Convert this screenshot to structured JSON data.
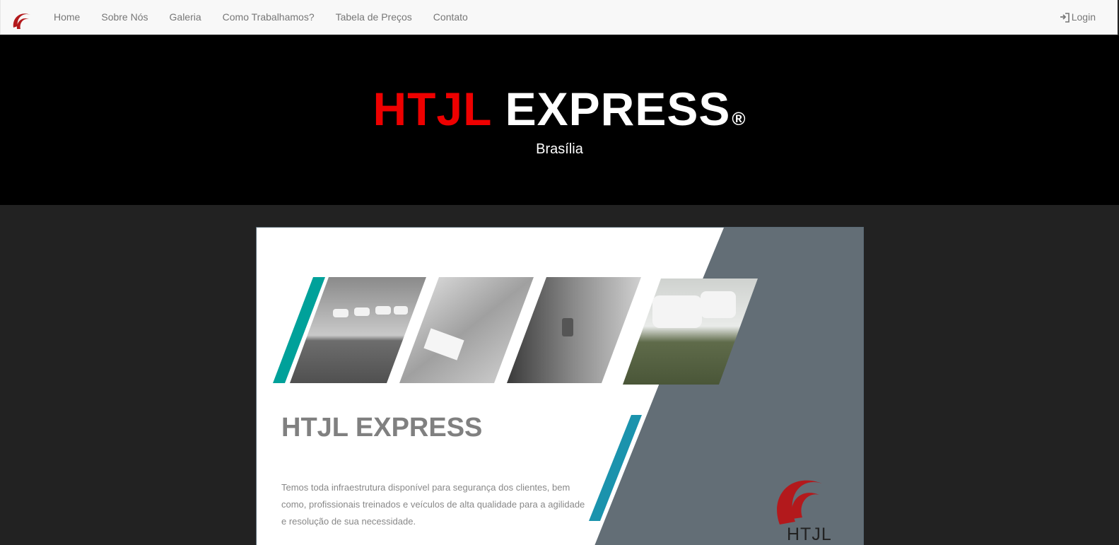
{
  "nav": {
    "logo_icon": "htjl-swirl-logo",
    "links": [
      "Home",
      "Sobre Nós",
      "Galeria",
      "Como Trabalhamos?",
      "Tabela de Preços",
      "Contato"
    ],
    "login_label": "Login",
    "login_icon": "sign-in-icon"
  },
  "hero": {
    "title_red": "HTJL",
    "title_white": "EXPRESS",
    "registered": "®",
    "subtitle": "Brasília"
  },
  "banner": {
    "title": "HTJL EXPRESS",
    "text": "Temos toda infraestrutura disponível para segurança dos clientes, bem como, profissionais treinados e veículos de alta qualidade  para a agilidade e resolução de sua necessidade.",
    "logo_text": "HTJL",
    "photos": [
      "parked-cars-photo",
      "laptop-typing-photo",
      "smartphone-suit-photo",
      "white-vans-photo"
    ]
  },
  "colors": {
    "accent_red": "#ee0000",
    "teal_stripe": "#00a19a",
    "blue_stripe": "#1b93ad",
    "slate_panel": "#636e76",
    "logo_red": "#b3191c"
  }
}
